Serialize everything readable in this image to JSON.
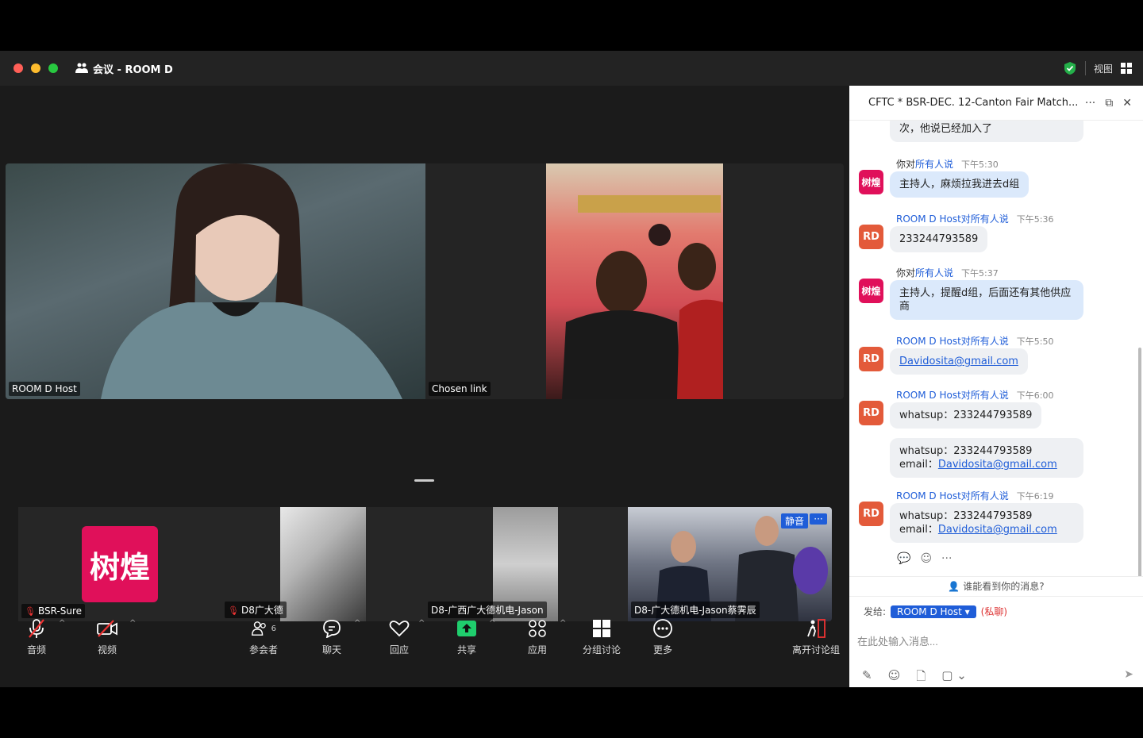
{
  "window": {
    "title": "会议 - ROOM D"
  },
  "titlebar_right": {
    "view_label": "视图"
  },
  "stage": {
    "tiles": [
      {
        "label": "ROOM D Host"
      },
      {
        "label": "Chosen link"
      }
    ],
    "strip": [
      {
        "label": "BSR-Sure",
        "avatar_text": "树煌",
        "muted": true
      },
      {
        "label": "D8广大德",
        "muted": true
      },
      {
        "label": "D8-广西广大德机电-Jason"
      },
      {
        "label": "D8-广大德机电-Jason蔡霁辰",
        "badge": "静音",
        "more": "···"
      }
    ]
  },
  "toolbar": {
    "audio": "音频",
    "video": "视频",
    "participants": "参会者",
    "participants_count": "6",
    "chat": "聊天",
    "reactions": "回应",
    "share": "共享",
    "apps": "应用",
    "breakout": "分组讨论",
    "more": "更多",
    "leave": "离开讨论组"
  },
  "chat": {
    "title": "CFTC * BSR-DEC. 12-Canton Fair Match...",
    "messages": [
      {
        "text": "次，他说已经加入了"
      },
      {
        "sender": "你对",
        "to": "所有人说",
        "time": "下午5:30",
        "avatar": "树煌",
        "text": "主持人，麻烦拉我进去d组"
      },
      {
        "sender": "ROOM D Host对",
        "to": "所有人说",
        "time": "下午5:36",
        "avatar": "RD",
        "text": "233244793589"
      },
      {
        "sender": "你对",
        "to": "所有人说",
        "time": "下午5:37",
        "avatar": "树煌",
        "text": "主持人，提醒d组，后面还有其他供应商"
      },
      {
        "sender": "ROOM D Host对",
        "to": "所有人说",
        "time": "下午5:50",
        "avatar": "RD",
        "text": "Davidosita@gmail.com"
      },
      {
        "sender": "ROOM D Host对",
        "to": "所有人说",
        "time": "下午6:00",
        "avatar": "RD",
        "text": "whatsup：233244793589"
      },
      {
        "line1": "whatsup：233244793589",
        "line2_label": "email：",
        "line2_link": "Davidosita@gmail.com"
      },
      {
        "sender": "ROOM D Host对",
        "to": "所有人说",
        "time": "下午6:19",
        "avatar": "RD",
        "line1": "whatsup：233244793589",
        "line2_label": "email：",
        "line2_link": "Davidosita@gmail.com"
      }
    ],
    "who_can_see": "谁能看到你的消息?",
    "send_to_label": "发给:",
    "recipient": "ROOM D Host ▾",
    "private": "(私聊)",
    "input_placeholder": "在此处输入消息..."
  }
}
